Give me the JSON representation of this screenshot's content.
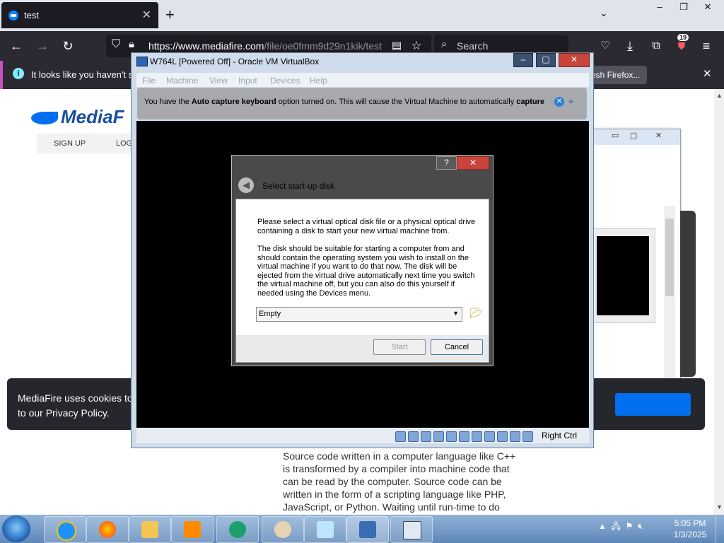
{
  "browser": {
    "tab_title": "test",
    "tab_close": "✕",
    "new_tab": "+",
    "tab_list": "⌄",
    "window_controls": [
      "–",
      "❐",
      "✕"
    ],
    "url_host": "https://www.mediafire.com",
    "url_path": "/file/oe0fmm9d29n1kik/test",
    "search_placeholder": "Search",
    "notif_badge": "19",
    "notification": {
      "message": "It looks like you haven't sta",
      "button": "esh Firefox...",
      "close": "✕"
    }
  },
  "page": {
    "logo_text": "MediaF",
    "nav_signup": "SIGN UP",
    "nav_login": "LOG",
    "cookie_line1": "MediaFire uses cookies to",
    "cookie_line2": "to our Privacy Policy.",
    "article": "Source code written in a computer language like C++ is transformed by a compiler into machine code that can be read by the computer. Source code can be written in the form of a scripting language like PHP, JavaScript, or Python. Waiting until run-time to do the translation"
  },
  "vbox": {
    "title": "W764L [Powered Off] - Oracle VM VirtualBox",
    "menu": [
      "File",
      "Machine",
      "View",
      "Input",
      "Devices",
      "Help"
    ],
    "notice_pre": "You have the ",
    "notice_b1": "Auto capture keyboard",
    "notice_mid": " option turned on. This will cause the Virtual Machine to automatically ",
    "notice_b2": "capture",
    "status_right": "Right Ctrl",
    "controls": [
      "–",
      "▢",
      "✕"
    ]
  },
  "dialog": {
    "title": "Select start-up disk",
    "help": "?",
    "close": "✕",
    "para1": "Please select a virtual optical disk file or a physical optical drive containing a disk to start your new virtual machine from.",
    "para2": "The disk should be suitable for starting a computer from and should contain the operating system you wish to install on the virtual machine if you want to do that now. The disk will be ejected from the virtual drive automatically next time you switch the virtual machine off, but you can also do this yourself if needed using the Devices menu.",
    "selected": "Empty",
    "start_label": "Start",
    "cancel_label": "Cancel"
  },
  "taskbar": {
    "time": "5:05 PM",
    "date": "1/3/2025"
  },
  "colors": {
    "accent": "#0a84ff",
    "brand": "#1a4fa0"
  }
}
